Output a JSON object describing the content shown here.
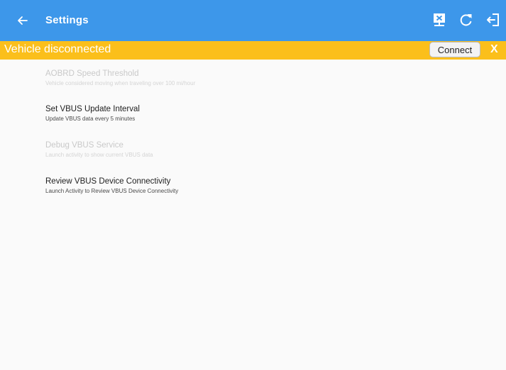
{
  "colors": {
    "app_bar": "#3d97ea",
    "banner": "#fbbf1b"
  },
  "app_bar": {
    "back_icon": "arrow-left-icon",
    "title": "Settings",
    "actions": [
      {
        "name": "disconnect-device-icon"
      },
      {
        "name": "refresh-icon"
      },
      {
        "name": "logout-icon"
      }
    ]
  },
  "banner": {
    "message": "Vehicle disconnected",
    "connect_label": "Connect",
    "dismiss_label": "X"
  },
  "settings": [
    {
      "title": "AOBRD Speed Threshold",
      "subtitle": "Vehicle considered moving when traveling over 100 mi/hour",
      "enabled": false
    },
    {
      "title": "Set VBUS Update Interval",
      "subtitle": "Update VBUS data every 5 minutes",
      "enabled": true
    },
    {
      "title": "Debug VBUS Service",
      "subtitle": "Launch activity to show current VBUS data",
      "enabled": false
    },
    {
      "title": "Review VBUS Device Connectivity",
      "subtitle": "Launch Activity to Review VBUS Device Connectivity",
      "enabled": true
    }
  ]
}
